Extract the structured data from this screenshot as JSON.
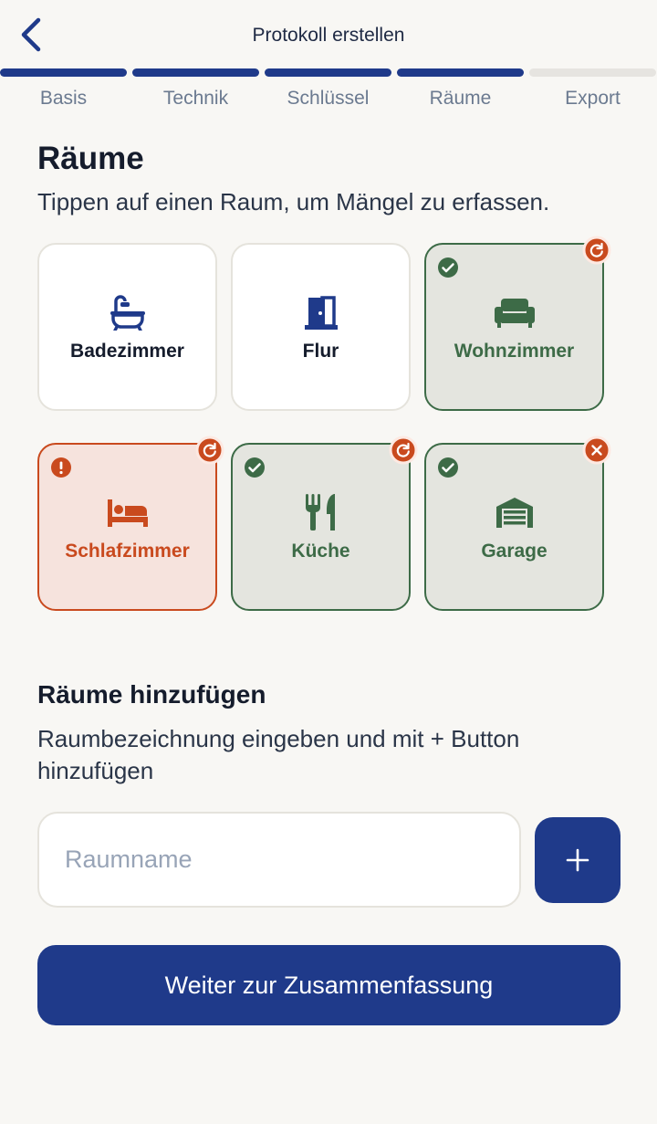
{
  "header": {
    "title": "Protokoll erstellen",
    "back_icon": "chevron-left-icon"
  },
  "steps": [
    {
      "label": "Basis",
      "done": true
    },
    {
      "label": "Technik",
      "done": true
    },
    {
      "label": "Schlüssel",
      "done": true
    },
    {
      "label": "Räume",
      "done": true
    },
    {
      "label": "Export",
      "done": false
    }
  ],
  "rooms_section": {
    "title": "Räume",
    "subtitle": "Tippen auf einen Raum, um Mängel zu erfassen.",
    "rooms": [
      {
        "name": "Badezimmer",
        "icon": "bathtub-icon",
        "state": "default"
      },
      {
        "name": "Flur",
        "icon": "door-icon",
        "state": "default"
      },
      {
        "name": "Wohnzimmer",
        "icon": "sofa-icon",
        "state": "done",
        "corner_badge": "reset-icon"
      },
      {
        "name": "Schlafzimmer",
        "icon": "bed-icon",
        "state": "issue",
        "corner_badge": "reset-icon"
      },
      {
        "name": "Küche",
        "icon": "utensils-icon",
        "state": "done",
        "corner_badge": "reset-icon"
      },
      {
        "name": "Garage",
        "icon": "garage-icon",
        "state": "done",
        "corner_badge": "close-icon"
      }
    ]
  },
  "add_section": {
    "title": "Räume hinzufügen",
    "description": "Raumbezeichnung eingeben und mit + Button hinzufügen",
    "input_placeholder": "Raumname",
    "input_value": "",
    "add_button_icon": "plus-icon"
  },
  "cta": {
    "label": "Weiter zur Zusammenfassung"
  },
  "colors": {
    "primary": "#1f3a8a",
    "success": "#3d6b47",
    "warning": "#c94a1e",
    "background": "#f8f7f4"
  }
}
